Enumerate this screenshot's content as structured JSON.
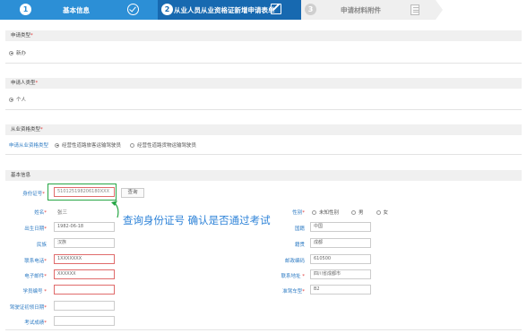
{
  "wizard": {
    "steps": [
      {
        "num": "1",
        "label": "基本信息"
      },
      {
        "num": "2",
        "label": "从业人员从业资格证新增申请表单"
      },
      {
        "num": "3",
        "label": "申请材料附件"
      }
    ]
  },
  "application_type": {
    "title": "申请类型",
    "option": "新办"
  },
  "applicant_type": {
    "title": "申请人类型",
    "option": "个人"
  },
  "qualification_type": {
    "title": "从业资格类型",
    "row_label": "申请从业资格类型",
    "options": [
      "经营性道路旅客运输驾驶员",
      "经营性道路货物运输驾驶员"
    ]
  },
  "basic_info": {
    "title": "基本信息",
    "id_label": "身份证号",
    "id_value": "510125198206180XXX",
    "query_button": "查询",
    "annotation": "查询身份证号 确认是否通过考试",
    "name_label": "姓名",
    "name_value": "张三",
    "gender_label": "性别",
    "gender_options": [
      "未知性别",
      "男",
      "女"
    ],
    "birth_label": "出生日期",
    "birth_value": "1982-06-18",
    "nationality_label": "国籍",
    "nationality_value": "中国",
    "ethnic_label": "民族",
    "ethnic_value": "汉族",
    "hometown_label": "籍贯",
    "hometown_value": "成都",
    "phone_label": "联系电话",
    "phone_value": "1XXXXXXX",
    "postcode_label": "邮政编码",
    "postcode_value": "610500",
    "email_label": "电子邮件",
    "email_value": "XXXXXX",
    "address_label": "联系地址",
    "address_value": "四川省成都市",
    "student_no_label": "学员编号",
    "student_no_value": "",
    "vehicle_label": "准驾车型",
    "vehicle_value": "B2",
    "license_date_label": "驾驶证初领日期",
    "license_date_value": "",
    "exam_score_label": "考试成绩",
    "exam_score_value": ""
  }
}
